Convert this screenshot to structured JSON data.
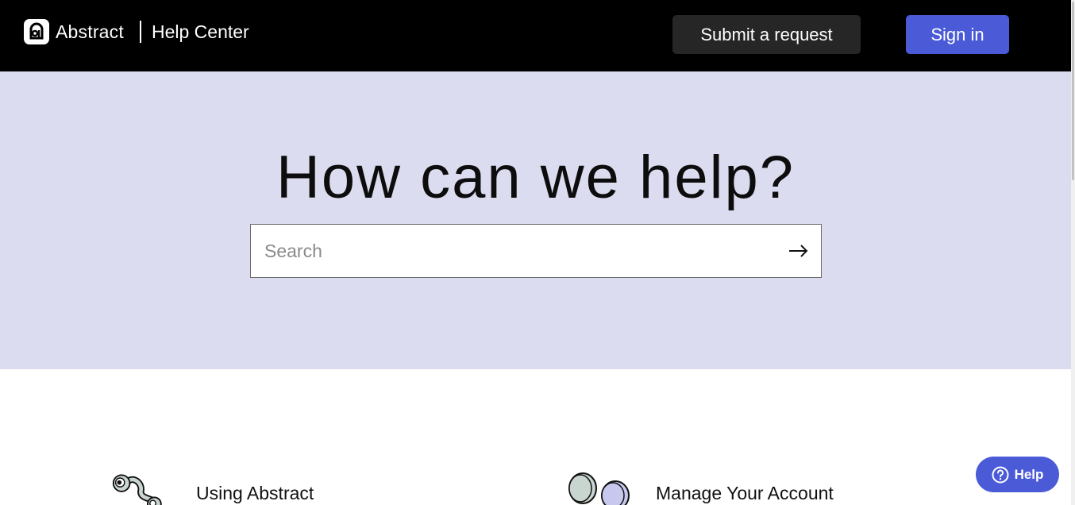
{
  "header": {
    "brand_name": "Abstract",
    "section_link": "Help Center",
    "submit_request_label": "Submit a request",
    "sign_in_label": "Sign in"
  },
  "hero": {
    "title": "How can we help?",
    "search": {
      "placeholder": "Search",
      "value": "",
      "submit_icon": "arrow-right-icon"
    }
  },
  "categories": [
    {
      "title": "Using Abstract",
      "icon": "eyeball-worm-illustration"
    },
    {
      "title": "Manage Your Account",
      "icon": "coins-illustration"
    }
  ],
  "help_widget": {
    "label": "Help",
    "icon": "question-circle-icon"
  },
  "colors": {
    "header_bg": "#000000",
    "hero_bg": "#dcdcf0",
    "accent": "#4b5bd8",
    "secondary_button": "#262626"
  }
}
